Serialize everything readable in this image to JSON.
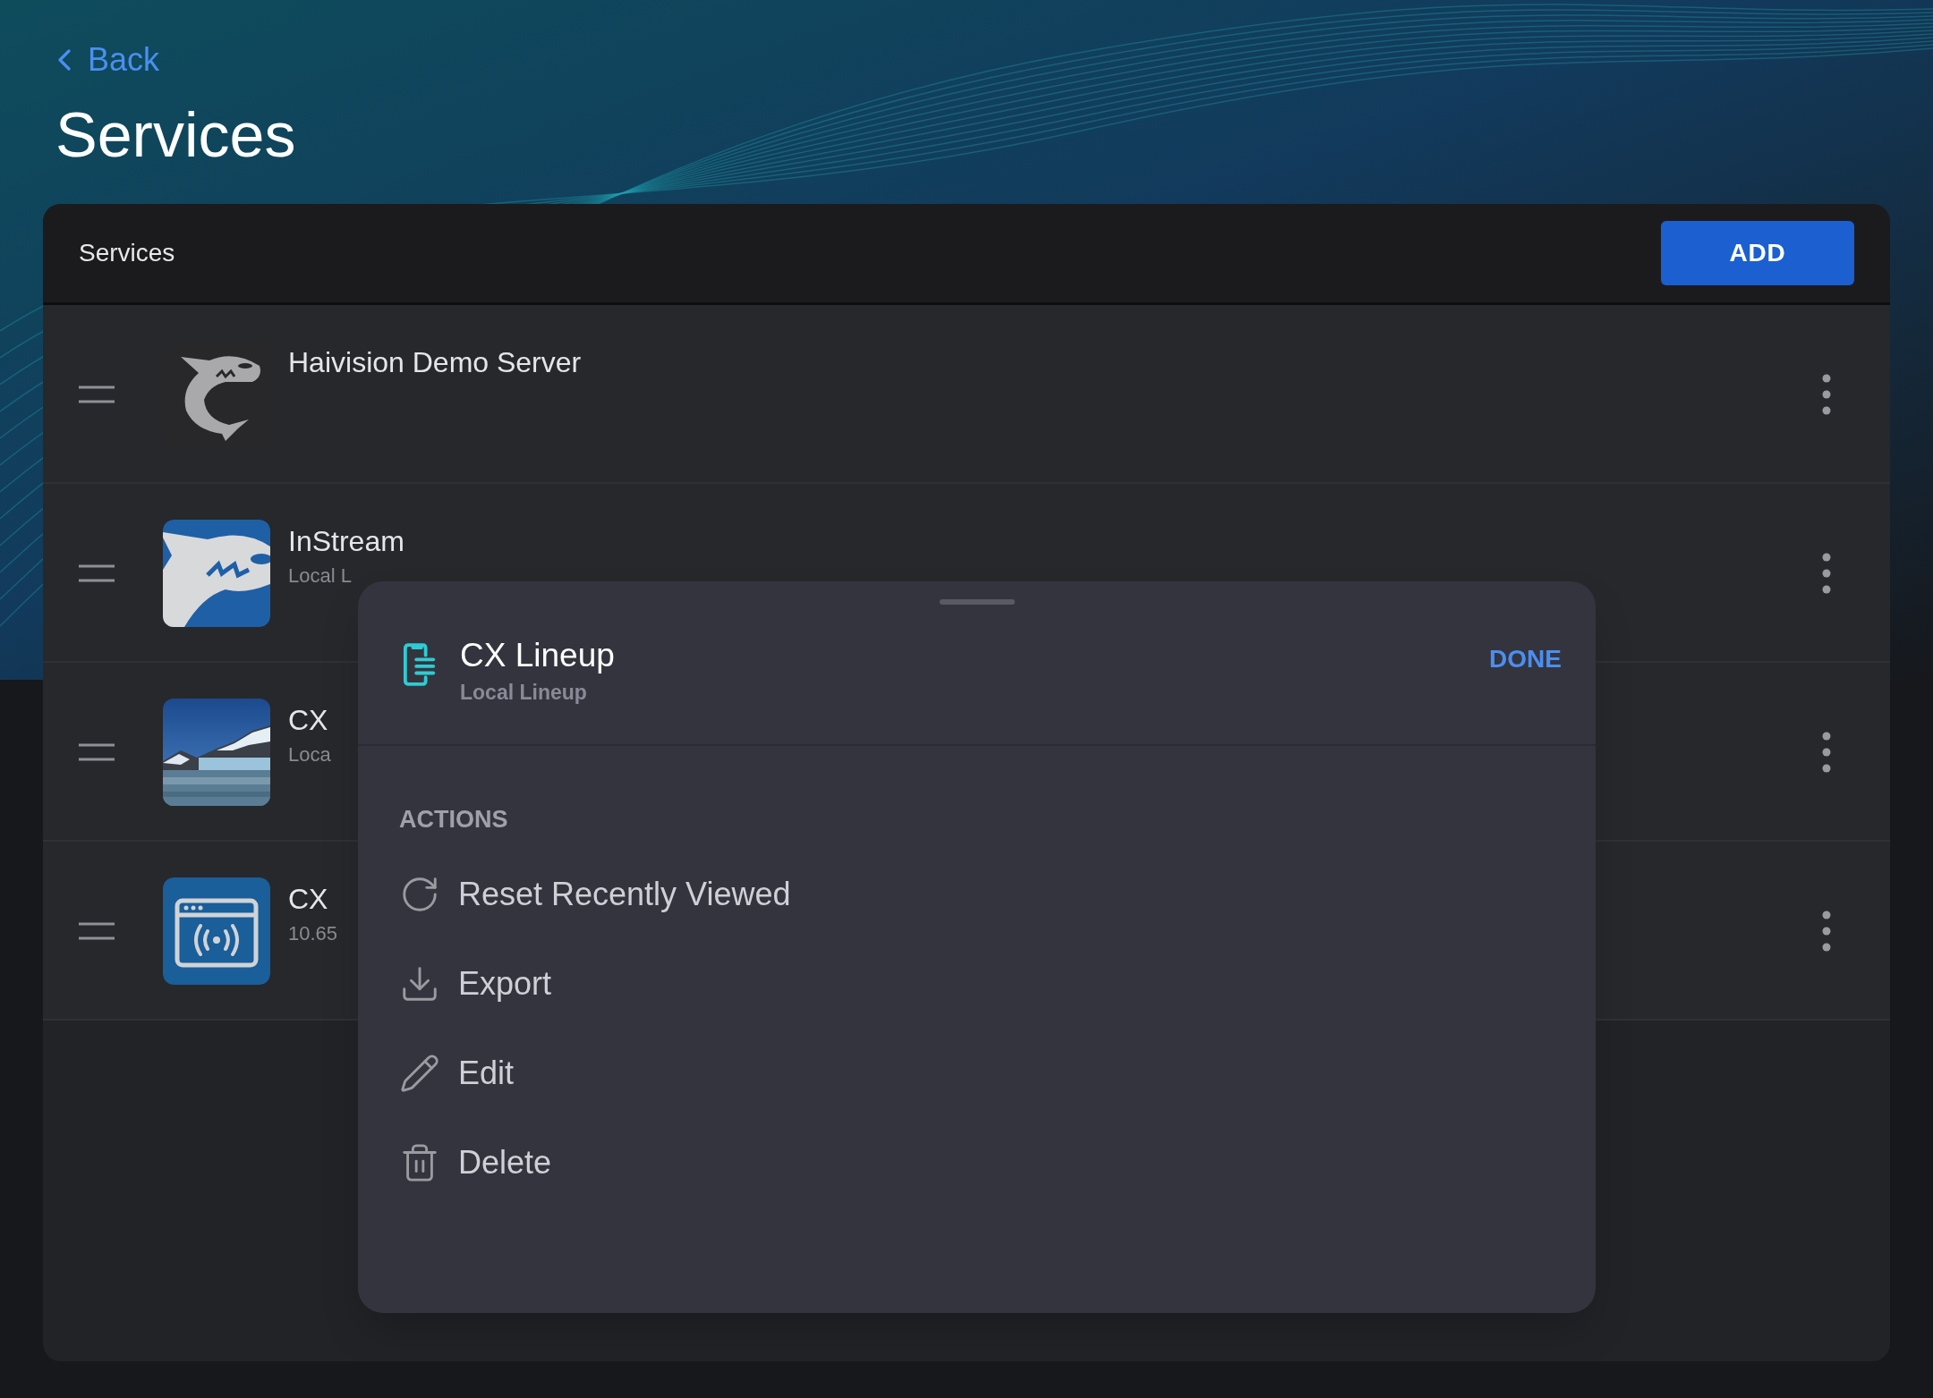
{
  "back": {
    "label": "Back"
  },
  "title": "Services",
  "panel": {
    "heading": "Services",
    "add_button": "ADD"
  },
  "services": [
    {
      "kind": "shark-gray",
      "name": "Haivision Demo Server"
    },
    {
      "kind": "shark-blue",
      "name": "InStream",
      "detail": "Local L"
    },
    {
      "kind": "picture",
      "name": "CX",
      "detail": "Loca"
    },
    {
      "kind": "broadcast",
      "name": "CX",
      "detail": "10.65"
    }
  ],
  "sheet": {
    "title": "CX Lineup",
    "subtitle": "Local Lineup",
    "done": "DONE",
    "section": "ACTIONS",
    "actions": [
      {
        "kind": "reset",
        "label": "Reset Recently Viewed"
      },
      {
        "kind": "export",
        "label": "Export"
      },
      {
        "kind": "edit",
        "label": "Edit"
      },
      {
        "kind": "delete",
        "label": "Delete"
      }
    ]
  }
}
